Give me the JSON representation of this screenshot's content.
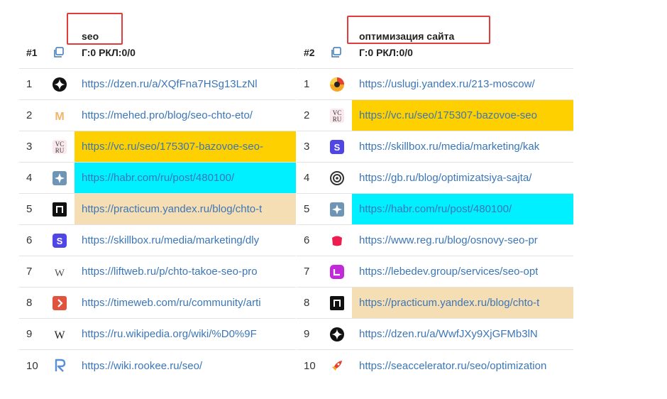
{
  "panels": [
    {
      "rank_label": "#1",
      "keyword": "seo",
      "stats": "Г:0 РКЛ:0/0",
      "rows": [
        {
          "n": "1",
          "icon": "dzen-icon",
          "url": "https://dzen.ru/a/XQfFna7HSg13LzNl",
          "hl": ""
        },
        {
          "n": "2",
          "icon": "mehed-icon",
          "url": "https://mehed.pro/blog/seo-chto-eto/",
          "hl": ""
        },
        {
          "n": "3",
          "icon": "vc-ru-icon",
          "url": "https://vc.ru/seo/175307-bazovoe-seo-",
          "hl": "gold"
        },
        {
          "n": "4",
          "icon": "habr-icon",
          "url": "https://habr.com/ru/post/480100/",
          "hl": "cyan"
        },
        {
          "n": "5",
          "icon": "practicum-icon",
          "url": "https://practicum.yandex.ru/blog/chto-t",
          "hl": "wheat"
        },
        {
          "n": "6",
          "icon": "skillbox-icon",
          "url": "https://skillbox.ru/media/marketing/dly",
          "hl": ""
        },
        {
          "n": "7",
          "icon": "liftweb-icon",
          "url": "https://liftweb.ru/p/chto-takoe-seo-pro",
          "hl": ""
        },
        {
          "n": "8",
          "icon": "timeweb-icon",
          "url": "https://timeweb.com/ru/community/arti",
          "hl": ""
        },
        {
          "n": "9",
          "icon": "wikipedia-icon",
          "url": "https://ru.wikipedia.org/wiki/%D0%9F",
          "hl": ""
        },
        {
          "n": "10",
          "icon": "rookee-icon",
          "url": "https://wiki.rookee.ru/seo/",
          "hl": ""
        }
      ]
    },
    {
      "rank_label": "#2",
      "keyword": "оптимизация сайта",
      "stats": "Г:0 РКЛ:0/0",
      "rows": [
        {
          "n": "1",
          "icon": "yandex-uslugi-icon",
          "url": "https://uslugi.yandex.ru/213-moscow/",
          "hl": ""
        },
        {
          "n": "2",
          "icon": "vc-ru-icon",
          "url": "https://vc.ru/seo/175307-bazovoe-seo",
          "hl": "gold"
        },
        {
          "n": "3",
          "icon": "skillbox-icon",
          "url": "https://skillbox.ru/media/marketing/kak",
          "hl": ""
        },
        {
          "n": "4",
          "icon": "gb-icon",
          "url": "https://gb.ru/blog/optimizatsiya-sajta/",
          "hl": ""
        },
        {
          "n": "5",
          "icon": "habr-icon",
          "url": "https://habr.com/ru/post/480100/",
          "hl": "cyan"
        },
        {
          "n": "6",
          "icon": "reg-ru-icon",
          "url": "https://www.reg.ru/blog/osnovy-seo-pr",
          "hl": ""
        },
        {
          "n": "7",
          "icon": "lebedev-icon",
          "url": "https://lebedev.group/services/seo-opt",
          "hl": ""
        },
        {
          "n": "8",
          "icon": "practicum-icon",
          "url": "https://practicum.yandex.ru/blog/chto-t",
          "hl": "wheat"
        },
        {
          "n": "9",
          "icon": "dzen-icon",
          "url": "https://dzen.ru/a/WwfJXy9XjGFMb3lN",
          "hl": ""
        },
        {
          "n": "10",
          "icon": "seaccelerator-icon",
          "url": "https://seaccelerator.ru/seo/optimization",
          "hl": ""
        }
      ]
    }
  ],
  "colors": {
    "link": "#3b76b8",
    "highlight_gold": "#ffd000",
    "highlight_cyan": "#00f0ff",
    "highlight_wheat": "#f5deb3",
    "annotation_box": "#e23b3b"
  }
}
